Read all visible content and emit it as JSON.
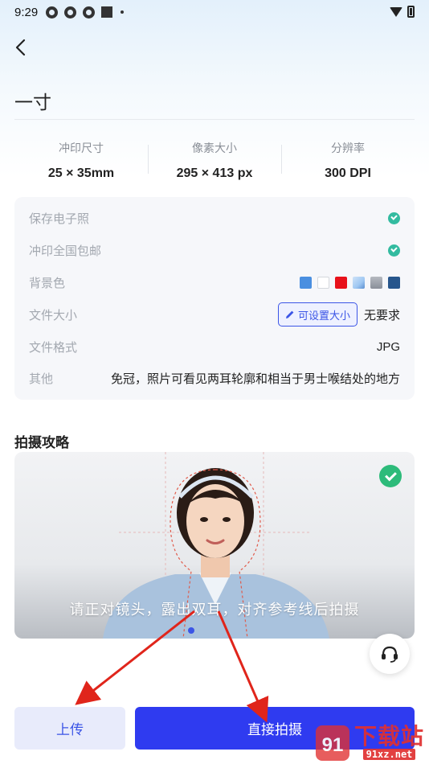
{
  "status_bar": {
    "time": "9:29"
  },
  "header": {
    "title": "一寸"
  },
  "specs": [
    {
      "label": "冲印尺寸",
      "value": "25 × 35mm"
    },
    {
      "label": "像素大小",
      "value": "295 × 413 px"
    },
    {
      "label": "分辨率",
      "value": "300 DPI"
    }
  ],
  "details": {
    "save_electronic": {
      "label": "保存电子照"
    },
    "print_shipping": {
      "label": "冲印全国包邮"
    },
    "background": {
      "label": "背景色",
      "swatches": [
        "#4a8fe0",
        "#ffffff",
        "#e8111a",
        "#9ec7f2",
        "#8a8f99",
        "#27568c"
      ]
    },
    "file_size": {
      "label": "文件大小",
      "button": "可设置大小",
      "value": "无要求"
    },
    "file_format": {
      "label": "文件格式",
      "value": "JPG"
    },
    "other": {
      "label": "其他",
      "value": "免冠，照片可看见两耳轮廓和相当于男士喉结处的地方"
    }
  },
  "guide": {
    "title": "拍摄攻略",
    "caption": "请正对镜头，露出双耳，对齐参考线后拍摄"
  },
  "actions": {
    "upload": "上传",
    "shoot": "直接拍摄"
  },
  "watermark": {
    "cn": "下载站",
    "url": "91xz.net",
    "logo": "91"
  },
  "colors": {
    "accent": "#2f3bf0",
    "check": "#33bba0",
    "arrow": "#e0251b"
  }
}
